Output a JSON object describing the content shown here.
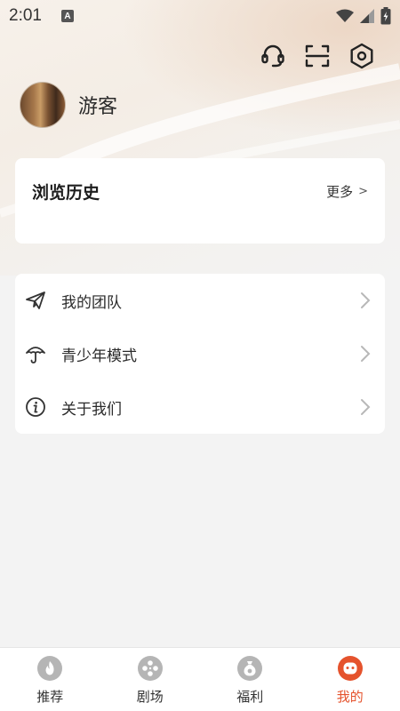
{
  "status_bar": {
    "time": "2:01",
    "notification_letter": "A"
  },
  "top_actions": [
    {
      "icon": "headset-icon"
    },
    {
      "icon": "scan-icon"
    },
    {
      "icon": "settings-hex-icon"
    }
  ],
  "profile": {
    "username": "游客"
  },
  "history": {
    "title": "浏览历史",
    "more_label": "更多",
    "more_arrow": ">"
  },
  "menu": {
    "items": [
      {
        "label": "我的团队",
        "icon": "paper-plane-icon"
      },
      {
        "label": "青少年模式",
        "icon": "umbrella-icon"
      },
      {
        "label": "关于我们",
        "icon": "info-icon"
      }
    ]
  },
  "bottom_nav": {
    "tabs": [
      {
        "label": "推荐",
        "icon": "flame-icon",
        "active": false
      },
      {
        "label": "剧场",
        "icon": "film-reel-icon",
        "active": false
      },
      {
        "label": "福利",
        "icon": "gift-bag-icon",
        "active": false
      },
      {
        "label": "我的",
        "icon": "profile-face-icon",
        "active": true
      }
    ]
  },
  "colors": {
    "accent": "#e5532d",
    "inactive_icon": "#b5b5b5",
    "card": "#ffffff",
    "background": "#f3f3f3"
  }
}
